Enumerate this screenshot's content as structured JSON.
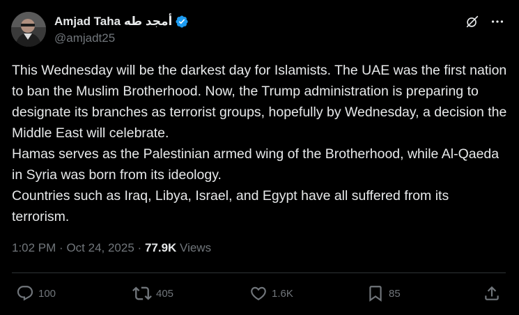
{
  "author": {
    "display_name": "Amjad Taha أمجد طه",
    "handle": "@amjadt25",
    "verified": true
  },
  "tweet": {
    "text": "This Wednesday will be the darkest day for Islamists. The UAE was the first nation to ban the Muslim Brotherhood. Now, the Trump administration is preparing to designate its branches as terrorist groups, hopefully by Wednesday, a decision the Middle East will celebrate.\nHamas serves as the Palestinian armed wing of the Brotherhood, while Al-Qaeda in Syria was born from its ideology.\nCountries such as Iraq, Libya, Israel, and Egypt have all suffered from its terrorism."
  },
  "meta": {
    "time": "1:02 PM",
    "separator": "·",
    "date": "Oct 24, 2025",
    "views_count": "77.9K",
    "views_label": "Views"
  },
  "actions": {
    "replies": "100",
    "reposts": "405",
    "likes": "1.6K",
    "bookmarks": "85"
  },
  "icons": {
    "top": [
      "grok-slash-icon",
      "more-dots-icon"
    ],
    "actions": [
      "reply-icon",
      "repost-icon",
      "like-icon",
      "bookmark-icon",
      "share-icon"
    ]
  },
  "colors": {
    "background": "#000000",
    "text": "#e7e9ea",
    "secondary_text": "#71767b",
    "verified": "#1d9bf0",
    "divider": "#2f3336"
  }
}
